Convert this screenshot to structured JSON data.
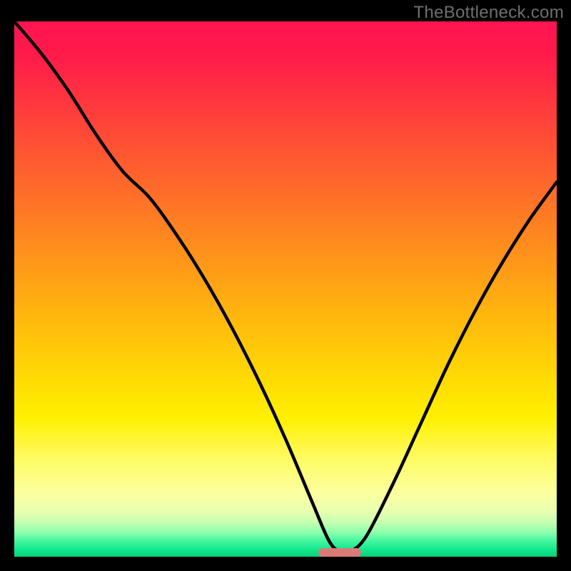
{
  "watermark_text": "TheBottleneck.com",
  "chart_data": {
    "type": "line",
    "title": "",
    "xlabel": "",
    "ylabel": "",
    "xlim": [
      0,
      100
    ],
    "ylim": [
      0,
      100
    ],
    "grid": false,
    "legend": false,
    "background": "red-yellow-green vertical gradient",
    "series": [
      {
        "name": "bottleneck-curve",
        "x": [
          0,
          5,
          10,
          15,
          20,
          25,
          30,
          35,
          40,
          45,
          50,
          55,
          58,
          60,
          62,
          65,
          70,
          75,
          80,
          85,
          90,
          95,
          100
        ],
        "y": [
          100,
          94,
          87,
          79,
          72,
          67,
          60,
          52,
          43,
          33,
          22,
          10,
          3,
          1,
          1,
          4,
          14,
          25,
          36,
          46,
          55,
          63,
          70
        ]
      }
    ],
    "marker": {
      "name": "optimal-range",
      "shape": "rounded-bar",
      "color": "#da7b77",
      "x_center": 60,
      "x_half_width": 4,
      "y": 0,
      "height_pct": 1.6
    },
    "gradient_stops": [
      {
        "pct": 0,
        "color": "#ff1452"
      },
      {
        "pct": 50,
        "color": "#ffba0c"
      },
      {
        "pct": 80,
        "color": "#fffb66"
      },
      {
        "pct": 100,
        "color": "#06d27a"
      }
    ]
  }
}
